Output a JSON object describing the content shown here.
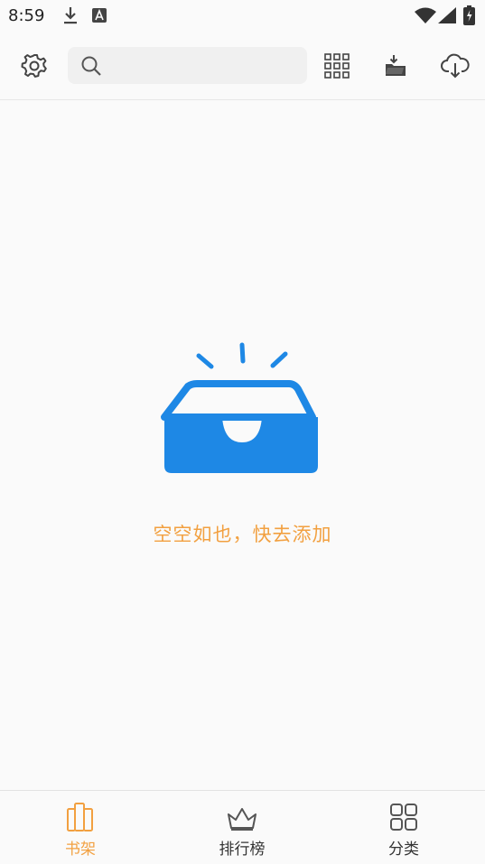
{
  "status_bar": {
    "time": "8:59",
    "icons": [
      "download-icon",
      "a-badge-icon",
      "wifi-icon",
      "signal-icon",
      "battery-icon"
    ]
  },
  "toolbar": {
    "settings_icon": "gear-icon",
    "search_placeholder": "",
    "grid_icon": "grid-view-icon",
    "import_icon": "import-icon",
    "cloud_icon": "cloud-download-icon"
  },
  "empty_state": {
    "icon": "empty-inbox-icon",
    "message": "空空如也，快去添加",
    "accent_color": "#1e88e5",
    "text_color": "#f2a040"
  },
  "bottom_nav": {
    "items": [
      {
        "label": "书架",
        "icon": "bookshelf-icon",
        "active": true
      },
      {
        "label": "排行榜",
        "icon": "crown-icon",
        "active": false
      },
      {
        "label": "分类",
        "icon": "category-grid-icon",
        "active": false
      }
    ]
  }
}
